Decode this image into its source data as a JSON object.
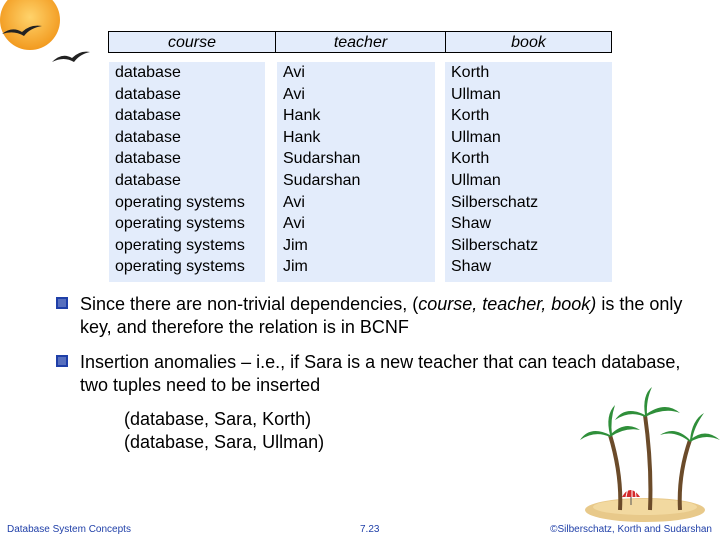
{
  "table": {
    "headers": [
      "course",
      "teacher",
      "book"
    ],
    "rows": [
      [
        "database",
        "Avi",
        "Korth"
      ],
      [
        "database",
        "Avi",
        "Ullman"
      ],
      [
        "database",
        "Hank",
        "Korth"
      ],
      [
        "database",
        "Hank",
        "Ullman"
      ],
      [
        "database",
        "Sudarshan",
        "Korth"
      ],
      [
        "database",
        "Sudarshan",
        "Ullman"
      ],
      [
        "operating systems",
        "Avi",
        "Silberschatz"
      ],
      [
        "operating systems",
        "Avi",
        "Shaw"
      ],
      [
        "operating systems",
        "Jim",
        "Silberschatz"
      ],
      [
        "operating systems",
        "Jim",
        "Shaw"
      ]
    ]
  },
  "bullets": [
    {
      "pre": "Since there are non-trivial dependencies, (",
      "italic": "course, teacher, book)",
      "post": " is the only key, and therefore the relation is in BCNF"
    },
    {
      "text": "Insertion anomalies – i.e., if Sara is a new teacher that can teach database, two tuples need to be inserted"
    }
  ],
  "examples": [
    "(database, Sara, Korth)",
    "(database, Sara, Ullman)"
  ],
  "footer": {
    "left": "Database System Concepts",
    "center": "7.23",
    "right": "©Silberschatz, Korth and Sudarshan"
  },
  "colors": {
    "table_bg": "#e3ecfb",
    "bullet": "#1f3fa8",
    "footer_text": "#1f3fa8",
    "sun": "#f5a623"
  }
}
